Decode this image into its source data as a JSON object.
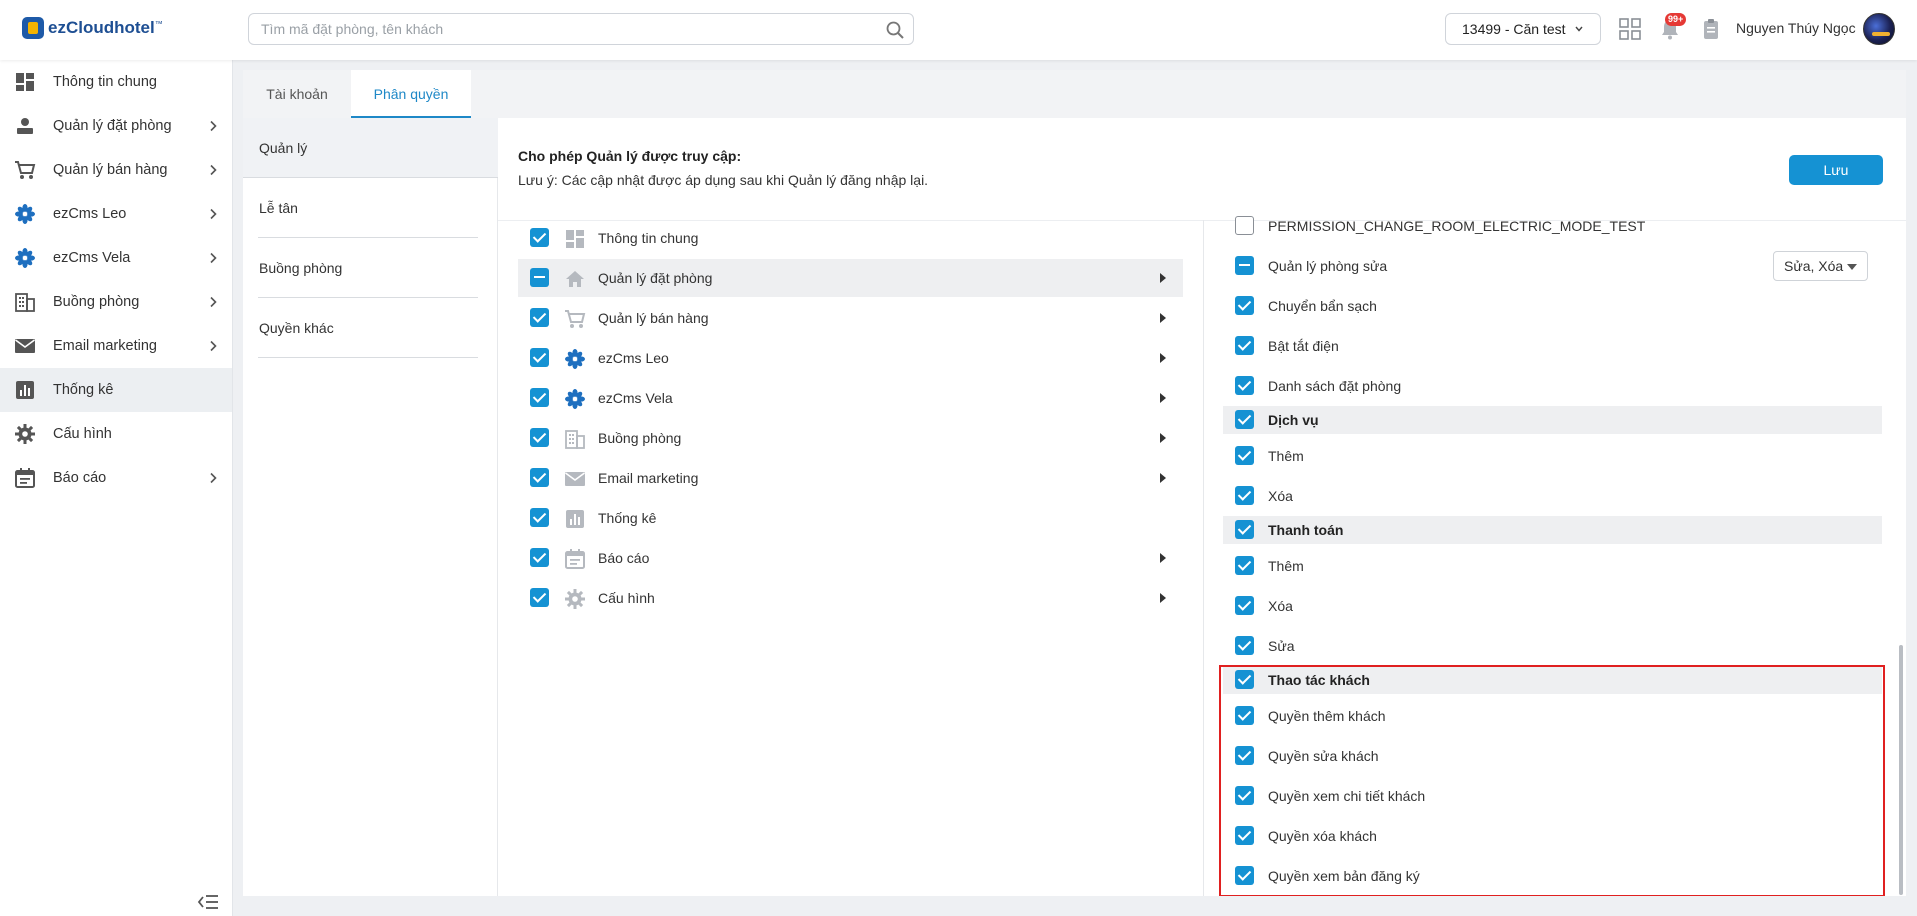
{
  "header": {
    "logo_text": "ezCloudhotel",
    "logo_tm": "™",
    "search_placeholder": "Tìm mã đặt phòng, tên khách",
    "hotel_selector": "13499 - Căn test",
    "notification_badge": "99+",
    "user_name": "Nguyen Thúy Ngọc"
  },
  "sidebar": {
    "items": [
      {
        "label": "Thông tin chung",
        "icon": "dashboard-icon",
        "has_arrow": false
      },
      {
        "label": "Quản lý đặt phòng",
        "icon": "booking-icon",
        "has_arrow": true
      },
      {
        "label": "Quản lý bán hàng",
        "icon": "cart-icon",
        "has_arrow": true
      },
      {
        "label": "ezCms Leo",
        "icon": "flower-icon",
        "has_arrow": true
      },
      {
        "label": "ezCms Vela",
        "icon": "flower-icon",
        "has_arrow": true
      },
      {
        "label": "Buồng phòng",
        "icon": "building-icon",
        "has_arrow": true
      },
      {
        "label": "Email marketing",
        "icon": "mail-icon",
        "has_arrow": true
      },
      {
        "label": "Thống kê",
        "icon": "bar-chart-icon",
        "has_arrow": false,
        "active": true
      },
      {
        "label": "Cấu hình",
        "icon": "gear-icon",
        "has_arrow": false
      },
      {
        "label": "Báo cáo",
        "icon": "calendar-icon",
        "has_arrow": true
      }
    ]
  },
  "tabs": [
    {
      "label": "Tài khoản",
      "active": false
    },
    {
      "label": "Phân quyền",
      "active": true
    }
  ],
  "roles": [
    {
      "label": "Quản lý",
      "active": true
    },
    {
      "label": "Lễ tân",
      "active": false
    },
    {
      "label": "Buồng phòng",
      "active": false
    },
    {
      "label": "Quyền khác",
      "active": false
    }
  ],
  "permissions": {
    "title": "Cho phép Quản lý được truy cập:",
    "note": "Lưu ý: Các cập nhật được áp dụng sau khi Quản lý đăng nhập lại.",
    "save_label": "Lưu"
  },
  "modules": [
    {
      "label": "Thông tin chung",
      "icon": "dashboard-icon",
      "state": "checked",
      "has_arrow": false
    },
    {
      "label": "Quản lý đặt phòng",
      "icon": "home-icon",
      "state": "partial",
      "has_arrow": true,
      "highlight": true
    },
    {
      "label": "Quản lý bán hàng",
      "icon": "cart-icon",
      "state": "checked",
      "has_arrow": true
    },
    {
      "label": "ezCms Leo",
      "icon": "flower-icon",
      "state": "checked",
      "has_arrow": true
    },
    {
      "label": "ezCms Vela",
      "icon": "flower-icon",
      "state": "checked",
      "has_arrow": true
    },
    {
      "label": "Buồng phòng",
      "icon": "building-icon",
      "state": "checked",
      "has_arrow": true
    },
    {
      "label": "Email marketing",
      "icon": "mail-icon",
      "state": "checked",
      "has_arrow": true
    },
    {
      "label": "Thống kê",
      "icon": "bar-chart-icon",
      "state": "checked",
      "has_arrow": false
    },
    {
      "label": "Báo cáo",
      "icon": "calendar-icon",
      "state": "checked",
      "has_arrow": true
    },
    {
      "label": "Cấu hình",
      "icon": "gear-icon",
      "state": "checked",
      "has_arrow": true
    }
  ],
  "detail_permissions": [
    {
      "label": "PERMISSION_CHANGE_ROOM_ELECTRIC_MODE_TEST",
      "state": "empty",
      "type": "item"
    },
    {
      "label": "Quản lý phòng sửa",
      "state": "partial",
      "type": "item",
      "dropdown": "Sửa, Xóa"
    },
    {
      "label": "Chuyển bẩn sạch",
      "state": "checked",
      "type": "item"
    },
    {
      "label": "Bật tắt điện",
      "state": "checked",
      "type": "item"
    },
    {
      "label": "Danh sách đặt phòng",
      "state": "checked",
      "type": "item"
    },
    {
      "label": "Dịch vụ",
      "state": "checked",
      "type": "group"
    },
    {
      "label": "Thêm",
      "state": "checked",
      "type": "item"
    },
    {
      "label": "Xóa",
      "state": "checked",
      "type": "item"
    },
    {
      "label": "Thanh toán",
      "state": "checked",
      "type": "group"
    },
    {
      "label": "Thêm",
      "state": "checked",
      "type": "item"
    },
    {
      "label": "Xóa",
      "state": "checked",
      "type": "item"
    },
    {
      "label": "Sửa",
      "state": "checked",
      "type": "item"
    },
    {
      "label": "Thao tác khách",
      "state": "checked",
      "type": "group"
    },
    {
      "label": "Quyền thêm khách",
      "state": "checked",
      "type": "item"
    },
    {
      "label": "Quyền sửa khách",
      "state": "checked",
      "type": "item"
    },
    {
      "label": "Quyền xem chi tiết khách",
      "state": "checked",
      "type": "item"
    },
    {
      "label": "Quyền xóa khách",
      "state": "checked",
      "type": "item"
    },
    {
      "label": "Quyền xem bản đăng ký",
      "state": "checked",
      "type": "item"
    }
  ],
  "colors": {
    "accent": "#1592d3",
    "highlight_border": "#e02020"
  }
}
